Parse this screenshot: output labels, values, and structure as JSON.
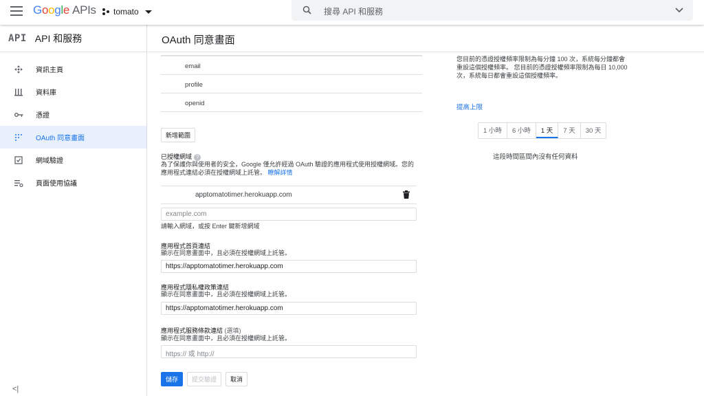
{
  "topbar": {
    "logo_google": [
      "G",
      "o",
      "o",
      "g",
      "l",
      "e"
    ],
    "logo_apis": "APIs",
    "project": "tomato",
    "search_placeholder": "搜尋 API 和服務"
  },
  "nav": {
    "title": "API 和服務",
    "api_logo": "API",
    "items": [
      {
        "label": "資訊主頁",
        "icon": "dashboard-icon"
      },
      {
        "label": "資料庫",
        "icon": "library-icon"
      },
      {
        "label": "憑證",
        "icon": "key-icon"
      },
      {
        "label": "OAuth 同意畫面",
        "icon": "oauth-consent-icon",
        "active": true
      },
      {
        "label": "網域驗證",
        "icon": "domain-verification-icon"
      },
      {
        "label": "頁面使用協議",
        "icon": "page-agreement-icon"
      }
    ],
    "collapse": "<|"
  },
  "page": {
    "title": "OAuth 同意畫面"
  },
  "scopes": [
    "email",
    "profile",
    "openid"
  ],
  "form": {
    "add_scope": "新增範圍",
    "authorized_domains_label": "已授權網域",
    "authorized_domains_help": "為了保護你與使用者的安全，Google 僅允許經過 OAuth 驗證的應用程式使用授權網域。您的應用程式連結必須在授權網域上託管。",
    "learn_more": "瞭解詳情",
    "domain": "apptomatotimer.herokuapp.com",
    "domain_input_placeholder": "example.com",
    "domain_input_help": "請輸入網域，或按 Enter 鍵新增網域",
    "homepage_label": "應用程式首頁連結",
    "homepage_help": "顯示在同意畫面中，且必須在授權網域上託管。",
    "homepage_value": "https://apptomatotimer.herokuapp.com",
    "privacy_label": "應用程式隱私權政策連結",
    "privacy_help": "顯示在同意畫面中，且必須在授權網域上託管。",
    "privacy_value": "https://apptomatotimer.herokuapp.com",
    "tos_label": "應用程式服務條款連結",
    "tos_optional": "(選填)",
    "tos_help": "顯示在同意畫面中，且必須在授權網域上託管。",
    "tos_placeholder": "https:// 或 http://",
    "save": "儲存",
    "submit": "提交驗證",
    "cancel": "取消"
  },
  "quota": {
    "text": "您目前的憑證授權頻率限制為每分鐘 100 次，系統每分鐘都會重設這個授權頻率。 您目前的憑證授權頻率限制為每日 10,000 次，系統每日都會重設這個授權頻率。",
    "raise": "提高上限",
    "tabs": [
      "1 小時",
      "6 小時",
      "1 天",
      "7 天",
      "30 天"
    ],
    "active_tab": "1 天",
    "nodata": "這段時間區間內沒有任何資料"
  },
  "colors": {
    "accent": "#1a73e8",
    "active_bg": "#e8f0fe"
  }
}
